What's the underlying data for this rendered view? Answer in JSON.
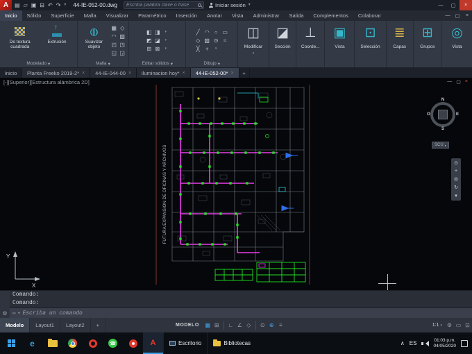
{
  "title_bar": {
    "logo_letter": "A",
    "filename": "44-IE-052-00.dwg",
    "search_placeholder": "Escriba palabra clave o frase",
    "sign_in_label": "Iniciar sesión"
  },
  "ribbon": {
    "tabs": [
      {
        "label": "Inicio"
      },
      {
        "label": "Sólido"
      },
      {
        "label": "Superficie"
      },
      {
        "label": "Malla"
      },
      {
        "label": "Visualizar"
      },
      {
        "label": "Paramétrico"
      },
      {
        "label": "Inserción"
      },
      {
        "label": "Anotar"
      },
      {
        "label": "Vista"
      },
      {
        "label": "Administrar"
      },
      {
        "label": "Salida"
      },
      {
        "label": "Complementos"
      },
      {
        "label": "Colaborar"
      }
    ],
    "buttons": {
      "textura_label": "De textura cuadrada",
      "extrusion_label": "Extrusión",
      "suavizar_label": "Suavizar objeto",
      "modificar_label": "Modificar",
      "seccion_label": "Sección",
      "coorde_label": "Coorde...",
      "vista_label": "Vista",
      "seleccion_label": "Selección",
      "capas_label": "Capas",
      "grupos_label": "Grupos",
      "vista2_label": "Vista"
    },
    "panel_labels": {
      "modelado": "Modelado",
      "malla": "Malla",
      "editar_solidos": "Editar sólidos",
      "dibujo": "Dibujo"
    }
  },
  "file_tabs": [
    {
      "label": "Inicio"
    },
    {
      "label": "Planta Freeko 2019-2*"
    },
    {
      "label": "44-IE-044-00"
    },
    {
      "label": "iluminacion hoy*"
    },
    {
      "label": "44-IE-052-00*"
    }
  ],
  "viewport": {
    "label": "[-][Superior][Estructura alámbrica 2D]",
    "compass_n": "N",
    "compass_s": "S",
    "compass_e": "E",
    "compass_w": "O",
    "scu_label": "SCU",
    "ucs_x": "X",
    "ucs_y": "Y",
    "drawing_note": "FUTURA EXPANSION DE OFICINAS Y ARCHIVOS"
  },
  "command": {
    "line1": "Comando:",
    "line2": "Comando:",
    "prompt_placeholder": "Escriba un comando"
  },
  "status_bar": {
    "layout_tabs": [
      {
        "label": "Modelo"
      },
      {
        "label": "Layout1"
      },
      {
        "label": "Layout2"
      }
    ],
    "add_layout_label": "+",
    "space_label": "MODELO",
    "scale_label": "1:1"
  },
  "taskbar": {
    "desktop_label": "Escritorio",
    "libraries_label": "Bibliotecas",
    "language_label": "ES",
    "time": "01:03 p.m.",
    "date": "04/05/2020"
  },
  "colors": {
    "circuit_magenta": "#e93eea",
    "fixture_green": "#21e321",
    "icon_teal": "#35b6c9",
    "taskbar_accent": "#3aa0e8"
  },
  "icons": {
    "qat-new": "▤",
    "qat-open": "▱",
    "qat-save": "▣",
    "qat-print": "⊟",
    "qat-undo": "↶",
    "qat-redo": "↷",
    "dropdown": "▾",
    "win-min": "—",
    "win-max": "▢",
    "win-close": "×",
    "tab-close": "×",
    "tab-new": "+",
    "extrude-arrow": "↑",
    "smooth-mesh": "◍",
    "mesh-1": "▦",
    "mesh-2": "◇",
    "mesh-3": "◠",
    "mesh-4": "▧",
    "mesh-5": "◰",
    "mesh-6": "◳",
    "mesh-7": "◱",
    "mesh-8": "◲",
    "solid-1": "◧",
    "solid-2": "◨",
    "solid-3": "◩",
    "solid-4": "◪",
    "solid-5": "⊞",
    "solid-6": "⊠",
    "draw-line": "╱",
    "draw-arc": "◠",
    "draw-circle": "○",
    "draw-rect": "▭",
    "draw-poly": "◇",
    "draw-hatch": "▨",
    "draw-donut": "⊙",
    "draw-spline": "≈",
    "draw-x": "╳",
    "draw-plus": "+",
    "modify": "◫",
    "section": "◪",
    "coords": "⊥",
    "view-big": "▣",
    "selection-big": "⊡",
    "layers-big": "≣",
    "groups-big": "⊞",
    "view2-big": "◎",
    "nav-1": "⊙",
    "nav-2": "+",
    "nav-3": "◎",
    "nav-4": "↻",
    "nav-5": "▾",
    "cmd-gear": "⚙",
    "cmd-box": "▭",
    "st-grid": "▦",
    "st-snap": "⊞",
    "st-ortho": "∟",
    "st-polar": "∠",
    "st-iso": "◇",
    "st-otrack": "⊙",
    "st-osnap": "⊕",
    "st-lw": "≡",
    "st-gear": "⚙",
    "st-iso2": "▭",
    "st-clean": "⊡",
    "tray-chevron": "∧",
    "whatsapp-phone": "☎",
    "edge-letter": "e",
    "acad-letter": "A"
  }
}
